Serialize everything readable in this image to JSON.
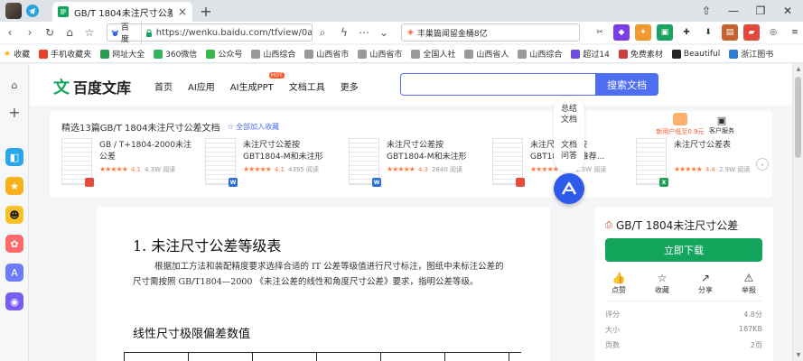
{
  "browser": {
    "tab_title": "GB/T 1804未注尺寸公差 - 百",
    "tab_close": "×",
    "new_tab": "+",
    "window_controls": [
      "⇧",
      "—",
      "❐",
      "✕"
    ],
    "nav_buttons": [
      "‹",
      "›",
      "↻",
      "⌂",
      "☆"
    ],
    "site_label": "百度",
    "url": "https://wenku.baidu.com/tfview/0a",
    "search_query": "丰巢篇闻留金桶8亿",
    "bookmarks": [
      "收藏",
      "手机收藏夹",
      "网址大全",
      "360微信",
      "公众号",
      "山西综合",
      "山西省市",
      "山西省市",
      "全国人社",
      "山西省人",
      "山西综合",
      "超过14",
      "免费素材",
      "Beautiful",
      "浙江图书"
    ]
  },
  "site": {
    "logo_text": "百度文库",
    "logo_mark": "文",
    "menu": [
      "首页",
      "AI应用",
      "AI生成PPT",
      "文档工具",
      "更多"
    ],
    "hot_badge": "HOT",
    "search_placeholder": "",
    "search_button": "搜索文档"
  },
  "recommend": {
    "title": "精选13篇GB/T 1804未注尺寸公差文档",
    "add_label": "☆ 全部加入收藏",
    "vip_label": "新用户低至0.9元",
    "service_label": "客户服务",
    "arrow": "›",
    "cards": [
      {
        "title": "GB / T+1804-2000未注公差",
        "stars": "★★★★★",
        "rating": "4.1",
        "views": "4.3W 阅读",
        "type": "PDF",
        "type_color": "#e34b3c"
      },
      {
        "title": "未注尺寸公差按GBT1804-M和未注形位...",
        "stars": "★★★★★",
        "rating": "4.1",
        "views": "4395 阅读",
        "type": "W",
        "type_color": "#2b6fd6"
      },
      {
        "title": "未注尺寸公差按GBT1804-M和未注形为...",
        "stars": "★★★★★",
        "rating": "4.3",
        "views": "2840 阅读",
        "type": "W",
        "type_color": "#2b6fd6"
      },
      {
        "title": "未注尺寸公差按GBT1804-M-推荐...",
        "stars": "★★★★★",
        "rating": "4.3",
        "views": "1.3W 阅读",
        "type": "PDF",
        "type_color": "#e34b3c"
      },
      {
        "title": "未注尺寸公差表",
        "stars": "★★★★★",
        "rating": "4.4",
        "views": "2.9W 阅读",
        "type": "X",
        "type_color": "#1f9d55"
      }
    ]
  },
  "float_tools": {
    "item1": "总结\n文档",
    "item2": "文档\n问答",
    "ai_label": "AI"
  },
  "document": {
    "heading": "1. 未注尺寸公差等级表",
    "paragraph": "根据加工方法和装配精度要求选择合适的 IT 公差等级值进行尺寸标注，图纸中未标注公差的尺寸需按照 GB/T1804—2000 《未注公差的线性和角度尺寸公差》要求，指明公差等级。",
    "subheading": "线性尺寸极限偏差数值"
  },
  "info": {
    "title": "GB/T 1804未注尺寸公差",
    "download": "立即下载",
    "actions": [
      {
        "icon": "👍",
        "label": "点赞"
      },
      {
        "icon": "☆",
        "label": "收藏"
      },
      {
        "icon": "↗",
        "label": "分享"
      },
      {
        "icon": "⚠",
        "label": "举报"
      }
    ],
    "rows": [
      {
        "label": "评分",
        "value": "4.8分"
      },
      {
        "label": "大小",
        "value": "187KB"
      },
      {
        "label": "页数",
        "value": "2页"
      }
    ]
  }
}
